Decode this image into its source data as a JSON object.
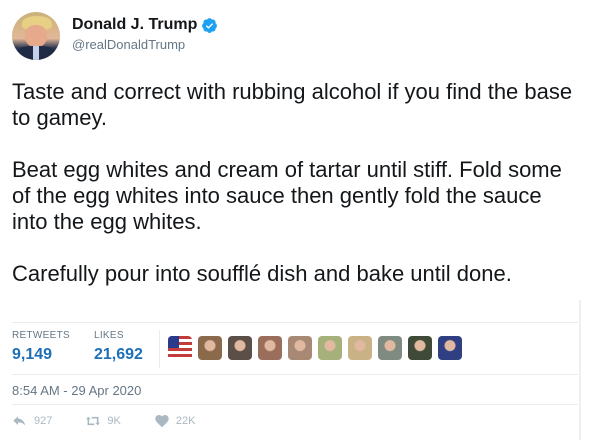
{
  "user": {
    "display_name": "Donald J. Trump",
    "handle": "@realDonaldTrump",
    "verified_icon": "verified-badge-icon"
  },
  "tweet": {
    "paragraphs": [
      "Taste and correct with rubbing alcohol if you find the base to gamey.",
      "Beat egg whites and cream of tartar until stiff. Fold some of the egg whites into sauce then gently fold the sauce into the egg whites.",
      "Carefully pour into soufflé dish and bake until done."
    ],
    "timestamp": "8:54 AM - 29 Apr 2020"
  },
  "stats": {
    "retweets_label": "RETWEETS",
    "retweets_value": "9,149",
    "likes_label": "LIKES",
    "likes_value": "21,692"
  },
  "liker_avatars": [
    {
      "icon": "avatar-flag",
      "color": "#c43b3b"
    },
    {
      "icon": "avatar-person",
      "color": "#8b6a4c"
    },
    {
      "icon": "avatar-person",
      "color": "#5c4f48"
    },
    {
      "icon": "avatar-person",
      "color": "#9b6e5c"
    },
    {
      "icon": "avatar-person",
      "color": "#a78975"
    },
    {
      "icon": "avatar-person",
      "color": "#a6b07a"
    },
    {
      "icon": "avatar-person",
      "color": "#c9b285"
    },
    {
      "icon": "avatar-person",
      "color": "#7f8a80"
    },
    {
      "icon": "avatar-person",
      "color": "#3f4a38"
    },
    {
      "icon": "avatar-person",
      "color": "#2f3f82"
    }
  ],
  "actions": {
    "reply_count": "927",
    "retweet_count": "9K",
    "like_count": "22K"
  },
  "colors": {
    "text": "#14171a",
    "secondary": "#657786",
    "stat_value": "#1d6fb8",
    "verified": "#1da1f2",
    "action_icon": "#aab8c2"
  }
}
